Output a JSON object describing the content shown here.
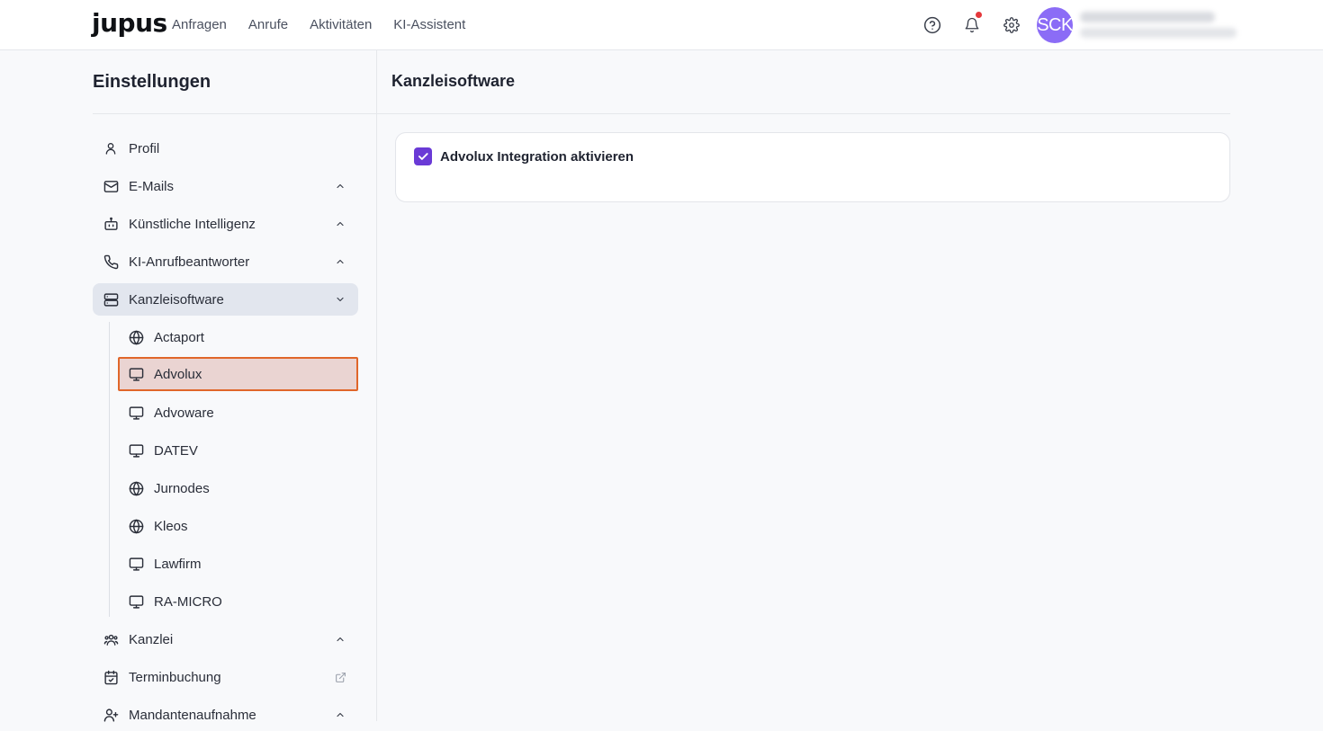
{
  "brand": {
    "logo_text": "jupus"
  },
  "nav": {
    "items": [
      {
        "label": "Anfragen"
      },
      {
        "label": "Anrufe"
      },
      {
        "label": "Aktivitäten"
      },
      {
        "label": "KI-Assistent"
      }
    ]
  },
  "header": {
    "help_icon": "question-circle-icon",
    "notification_icon": "bell-icon",
    "settings_icon": "gear-icon",
    "avatar_initials": "SCK",
    "notification_dot_color": "#e5383b",
    "avatar_color": "#8b6cf6"
  },
  "sidebar": {
    "title": "Einstellungen",
    "items": [
      {
        "label": "Profil",
        "icon": "user-icon"
      },
      {
        "label": "E-Mails",
        "icon": "mail-icon"
      },
      {
        "label": "Künstliche Intelligenz",
        "icon": "bot-icon"
      },
      {
        "label": "KI-Anrufbeantworter",
        "icon": "phone-icon"
      },
      {
        "label": "Kanzleisoftware",
        "icon": "server-icon"
      },
      {
        "label": "Kanzlei",
        "icon": "users-icon"
      },
      {
        "label": "Terminbuchung",
        "icon": "calendar-check-icon"
      },
      {
        "label": "Mandantenaufnahme",
        "icon": "user-plus-icon"
      }
    ],
    "sub_items": [
      {
        "label": "Actaport",
        "icon": "globe-icon"
      },
      {
        "label": "Advolux",
        "icon": "monitor-icon"
      },
      {
        "label": "Advoware",
        "icon": "monitor-icon"
      },
      {
        "label": "DATEV",
        "icon": "monitor-icon"
      },
      {
        "label": "Jurnodes",
        "icon": "globe-icon"
      },
      {
        "label": "Kleos",
        "icon": "globe-icon"
      },
      {
        "label": "Lawfirm",
        "icon": "monitor-icon"
      },
      {
        "label": "RA-MICRO",
        "icon": "monitor-icon"
      }
    ],
    "selected_sub_item": "Advolux"
  },
  "main": {
    "title": "Kanzleisoftware",
    "checkbox": {
      "label": "Advolux Integration aktivieren",
      "checked": true,
      "color": "#6a3ad6"
    }
  }
}
